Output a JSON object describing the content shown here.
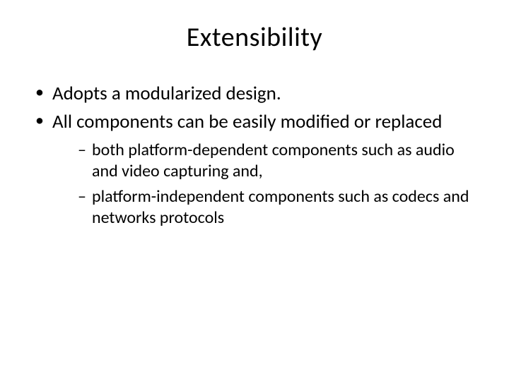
{
  "title": "Extensibility",
  "bullets": {
    "b1": "Adopts a modularized design.",
    "b2": "All components can be easily modified or replaced",
    "sub1": "both platform-dependent components such as audio and video capturing and,",
    "sub2": "platform-independent components such as codecs and networks protocols"
  }
}
